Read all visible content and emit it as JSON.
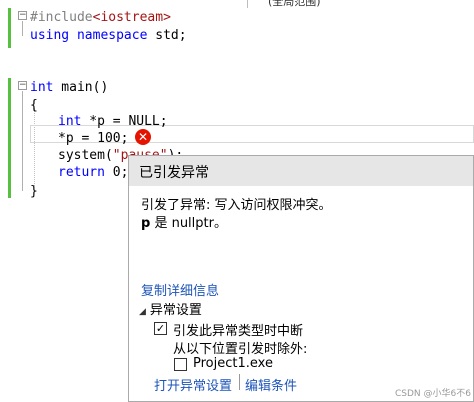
{
  "toolbar": {
    "scope_label": "(全局范围)"
  },
  "code": {
    "line1": {
      "directive": "#include",
      "header": "<iostream>"
    },
    "line2": {
      "kw1": "using",
      "kw2": "namespace",
      "rest": " std;"
    },
    "line4": {
      "kw": "int",
      "rest": " main()"
    },
    "line5": {
      "text": "{"
    },
    "line6": {
      "kw": "int",
      "rest": " *p = NULL;"
    },
    "line7": {
      "text": "*p = 100;"
    },
    "line8": {
      "pre": "system(",
      "str": "\"pause\"",
      "post": ");"
    },
    "line9": {
      "kw": "return",
      "rest": " 0;"
    },
    "line10": {
      "text": "}"
    }
  },
  "exception_popup": {
    "title": "已引发异常",
    "message_line1": "引发了异常: 写入访问权限冲突。",
    "message_var": "p",
    "message_line2_rest": " 是 nullptr。",
    "copy_details_link": "复制详细信息",
    "settings_section": "异常设置",
    "break_checkbox_label": "引发此异常类型时中断",
    "break_checkbox_checked": true,
    "except_label": "从以下位置引发时除外:",
    "module_checkbox_label": "Project1.exe",
    "module_checkbox_checked": false,
    "open_settings_link": "打开异常设置",
    "edit_conditions_link": "编辑条件"
  },
  "watermark": "CSDN @小华6不6",
  "colors": {
    "keyword": "#0000ff",
    "string": "#a31515",
    "link": "#1e55b9",
    "error": "#e51400",
    "change_bar": "#57c041"
  }
}
